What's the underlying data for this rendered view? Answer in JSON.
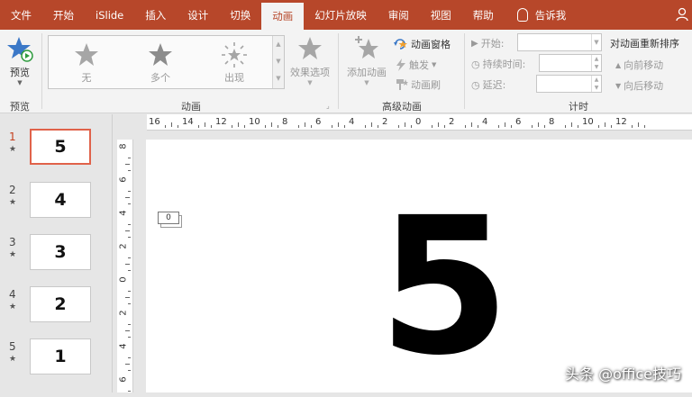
{
  "menu": {
    "tabs": [
      "文件",
      "开始",
      "iSlide",
      "插入",
      "设计",
      "切换",
      "动画",
      "幻灯片放映",
      "审阅",
      "视图",
      "帮助"
    ],
    "active_tab": "动画",
    "tell_me": "告诉我"
  },
  "ribbon": {
    "preview": {
      "label": "预览",
      "group_label": "预览"
    },
    "animation_group": {
      "items": [
        {
          "label": "无",
          "icon": "star-outline-icon"
        },
        {
          "label": "多个",
          "icon": "star-icon"
        },
        {
          "label": "出现",
          "icon": "star-burst-icon"
        }
      ],
      "effect_options": "效果选项",
      "group_label": "动画"
    },
    "advanced_group": {
      "add_animation": "添加动画",
      "animation_pane": "动画窗格",
      "trigger": "触发",
      "animation_painter": "动画刷",
      "group_label": "高级动画"
    },
    "timing_group": {
      "start_label": "开始:",
      "start_value": "",
      "duration_label": "持续时间:",
      "duration_value": "",
      "delay_label": "延迟:",
      "delay_value": "",
      "group_label": "计时"
    },
    "reorder": {
      "title": "对动画重新排序",
      "move_earlier": "向前移动",
      "move_later": "向后移动"
    }
  },
  "thumbnails": [
    {
      "index": "1",
      "content": "5",
      "active": true
    },
    {
      "index": "2",
      "content": "4",
      "active": false
    },
    {
      "index": "3",
      "content": "3",
      "active": false
    },
    {
      "index": "4",
      "content": "2",
      "active": false
    },
    {
      "index": "5",
      "content": "1",
      "active": false
    }
  ],
  "rulers": {
    "horizontal_labels": [
      "16",
      "14",
      "12",
      "10",
      "8",
      "6",
      "4",
      "2",
      "0",
      "2",
      "4",
      "6",
      "8",
      "10",
      "12"
    ],
    "vertical_labels": [
      "8",
      "6",
      "4",
      "2",
      "0",
      "2",
      "4",
      "6"
    ]
  },
  "slide": {
    "animation_tag": "0",
    "main_text": "5"
  },
  "watermark": "头条 @office技巧",
  "colors": {
    "menubar": "#b7472a",
    "ribbon": "#f3f3f3",
    "active_thumb_border": "#e0624a",
    "active_thumb_index": "#c43e1c"
  }
}
